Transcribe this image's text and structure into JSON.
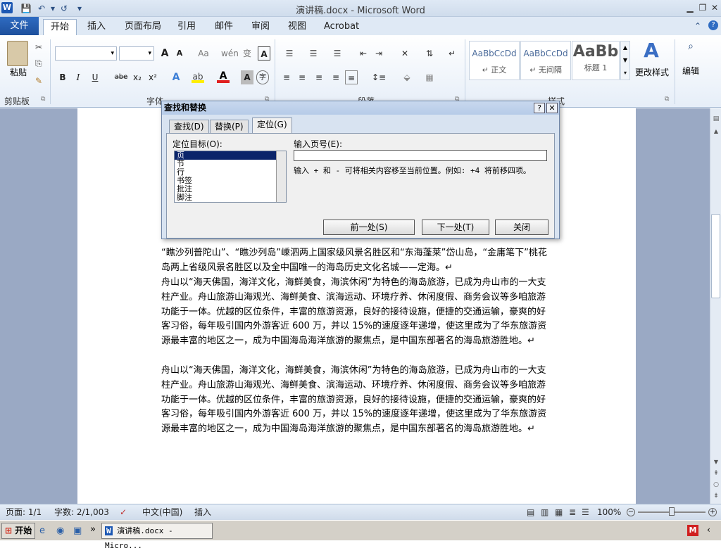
{
  "window": {
    "title": "演讲稿.docx - Microsoft Word",
    "app_icon": "W"
  },
  "quick_access": {
    "save": "💾",
    "undo": "↶",
    "undo_more": "▾",
    "redo": "↺",
    "customize": "▾"
  },
  "tabs": [
    {
      "label": "文件"
    },
    {
      "label": "开始"
    },
    {
      "label": "插入"
    },
    {
      "label": "页面布局"
    },
    {
      "label": "引用"
    },
    {
      "label": "邮件"
    },
    {
      "label": "审阅"
    },
    {
      "label": "视图"
    },
    {
      "label": "Acrobat"
    }
  ],
  "ribbon": {
    "clipboard": {
      "paste": "粘贴",
      "group": "剪贴板"
    },
    "font": {
      "group": "字体",
      "grow": "A",
      "shrink": "A",
      "aa": "Aa",
      "bold": "B",
      "italic": "I",
      "underline": "U",
      "strike": "abe",
      "sub": "x₂",
      "sup": "x²"
    },
    "paragraph": {
      "group": "段落"
    },
    "styles": {
      "group": "样式",
      "items": [
        {
          "sample": "AaBbCcDd",
          "name": "↵ 正文"
        },
        {
          "sample": "AaBbCcDd",
          "name": "↵ 无间隔"
        },
        {
          "sample": "AaBb",
          "name": "标题 1"
        }
      ],
      "change": "更改样式"
    },
    "editing": {
      "label": "编辑"
    }
  },
  "document": {
    "paragraphs": [
      "“瞧沙列普陀山”、“瞧沙列岛”嵊泗两上国家级风景名胜区和“东海蓬莱”岱山岛，“金庸笔下”桃花岛两上省级风景名胜区以及全中国唯一的海岛历史文化名城——定海。↵",
      "舟山以“海天佛国，海洋文化，海鲜美食，海滨休闲”为特色的海岛旅游，已成为舟山市的一大支柱产业。舟山旅游山海观光、海鲜美食、滨海运动、环境疗养、休闲度假、商务会议等多咱旅游功能于一体。优越的区位条件，丰富的旅游资源，良好的接待设施，便捷的交通运输，豪爽的好客习俗，每年吸引国内外游客近 600 万，并以 15%的速度逐年递增，使这里成为了华东旅游资源最丰富的地区之一，成为中国海岛海洋旅游的聚焦点，是中国东部著名的海岛旅游胜地。↵",
      "舟山以“海天佛国，海洋文化，海鲜美食，海滨休闲”为特色的海岛旅游，已成为舟山市的一大支柱产业。舟山旅游山海观光、海鲜美食、滨海运动、环境疗养、休闲度假、商务会议等多咱旅游功能于一体。优越的区位条件，丰富的旅游资源，良好的接待设施，便捷的交通运输，豪爽的好客习俗，每年吸引国内外游客近 600 万，并以 15%的速度逐年递增，使这里成为了华东旅游资源最丰富的地区之一，成为中国海岛海洋旅游的聚焦点，是中国东部著名的海岛旅游胜地。↵"
    ]
  },
  "dialog": {
    "title": "查找和替换",
    "help": "?",
    "close": "✕",
    "tabs": [
      {
        "label": "查找(D)"
      },
      {
        "label": "替换(P)"
      },
      {
        "label": "定位(G)"
      }
    ],
    "goto_label": "定位目标(O):",
    "goto_items": [
      "页",
      "节",
      "行",
      "书签",
      "批注",
      "脚注"
    ],
    "page_label": "输入页号(E):",
    "page_value": "",
    "hint": "输入 + 和 - 可将相关内容移至当前位置。例如: +4 将前移四项。",
    "buttons": {
      "prev": "前一处(S)",
      "next": "下一处(T)",
      "close": "关闭"
    }
  },
  "status": {
    "page": "页面: 1/1",
    "words": "字数: 2/1,003",
    "lang": "中文(中国)",
    "mode": "插入",
    "zoom": "100%"
  },
  "taskbar": {
    "start": "开始",
    "task": "演讲稿.docx - Micro...",
    "expand": "»"
  }
}
